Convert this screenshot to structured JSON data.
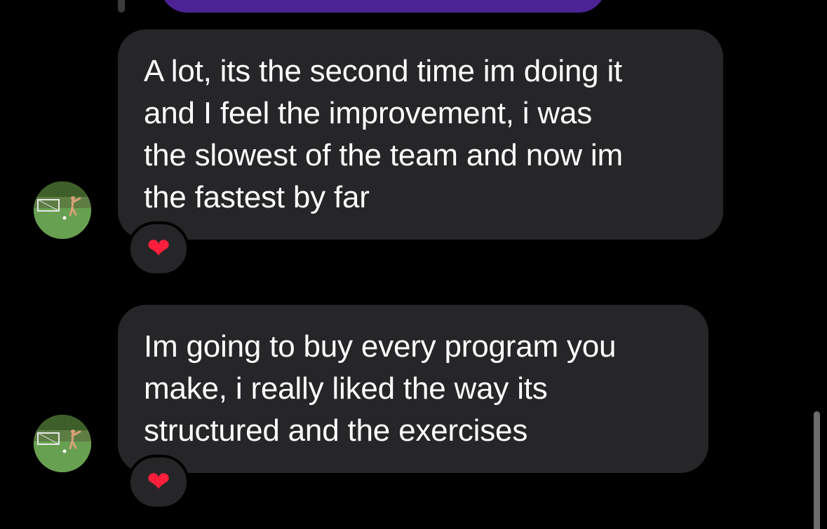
{
  "messages": [
    {
      "text": "A lot, its the second time im doing it\nand I feel the improvement, i was\nthe slowest of the team and now im\nthe fastest by far",
      "reaction": "❤"
    },
    {
      "text": "Im going to buy every program you\nmake, i really liked the way its\nstructured and the exercises",
      "reaction": "❤"
    }
  ],
  "colors": {
    "background": "#000000",
    "received_bubble": "#262628",
    "sent_bubble": "#4b2394",
    "heart": "#ff1f3d"
  },
  "icons": {
    "avatar": "avatar-soccer-photo",
    "reaction": "red-heart-emoji"
  }
}
